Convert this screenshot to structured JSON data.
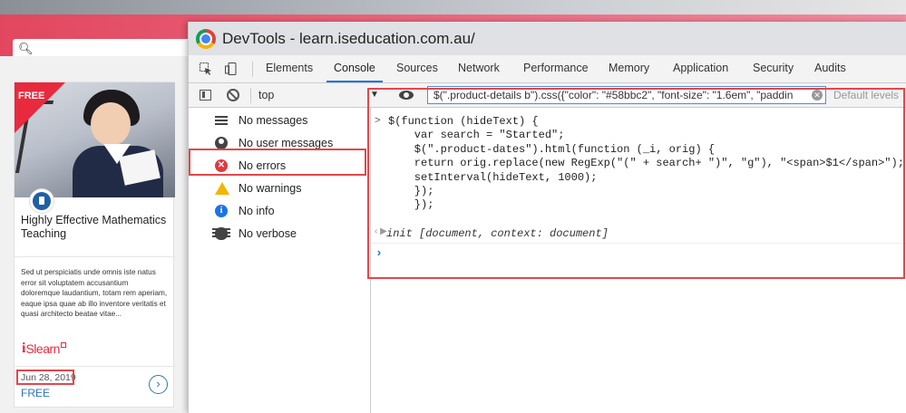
{
  "page": {
    "card": {
      "ribbon": "FREE",
      "title": "Highly Effective Mathematics Teaching",
      "description": "Sed ut perspiciatis unde omnis iste natus error sit voluptatem accusantium doloremque laudantium, totam rem aperiam, eaque ipsa quae ab illo inventore veritatis et quasi architecto beatae vitae...",
      "logo_i": "i",
      "logo_rest": "Slearn",
      "date": "Jun 28, 2019",
      "price": "FREE"
    }
  },
  "devtools": {
    "title": "DevTools - learn.iseducation.com.au/",
    "tabs": [
      "Elements",
      "Console",
      "Sources",
      "Network",
      "Performance",
      "Memory",
      "Application",
      "Security",
      "Audits"
    ],
    "active_tab": "Console",
    "toolbar": {
      "context": "top",
      "filter_value": "$(\".product-details b\").css({\"color\": \"#58bbc2\", \"font-size\": \"1.6em\", \"paddin",
      "levels": "Default levels"
    },
    "sidebar": [
      {
        "icon": "list-icon",
        "label": "No messages"
      },
      {
        "icon": "user-icon",
        "label": "No user messages"
      },
      {
        "icon": "error-icon",
        "label": "No errors"
      },
      {
        "icon": "warning-icon",
        "label": "No warnings"
      },
      {
        "icon": "info-icon",
        "label": "No info"
      },
      {
        "icon": "bug-icon",
        "label": "No verbose"
      }
    ],
    "console": {
      "code_lines": [
        "$(function (hideText) {",
        "    var search = \"Started\";",
        "    $(\".product-dates\").html(function (_i, orig) {",
        "    return orig.replace(new RegExp(\"(\" + search+ \")\", \"g\"), \"<span>$1</span>\");",
        "    setInterval(hideText, 1000);",
        "    });",
        "    });"
      ],
      "result": "init [document, context: document]"
    },
    "accent_color": "#1a73e8",
    "highlight_color": "#e2474b"
  }
}
